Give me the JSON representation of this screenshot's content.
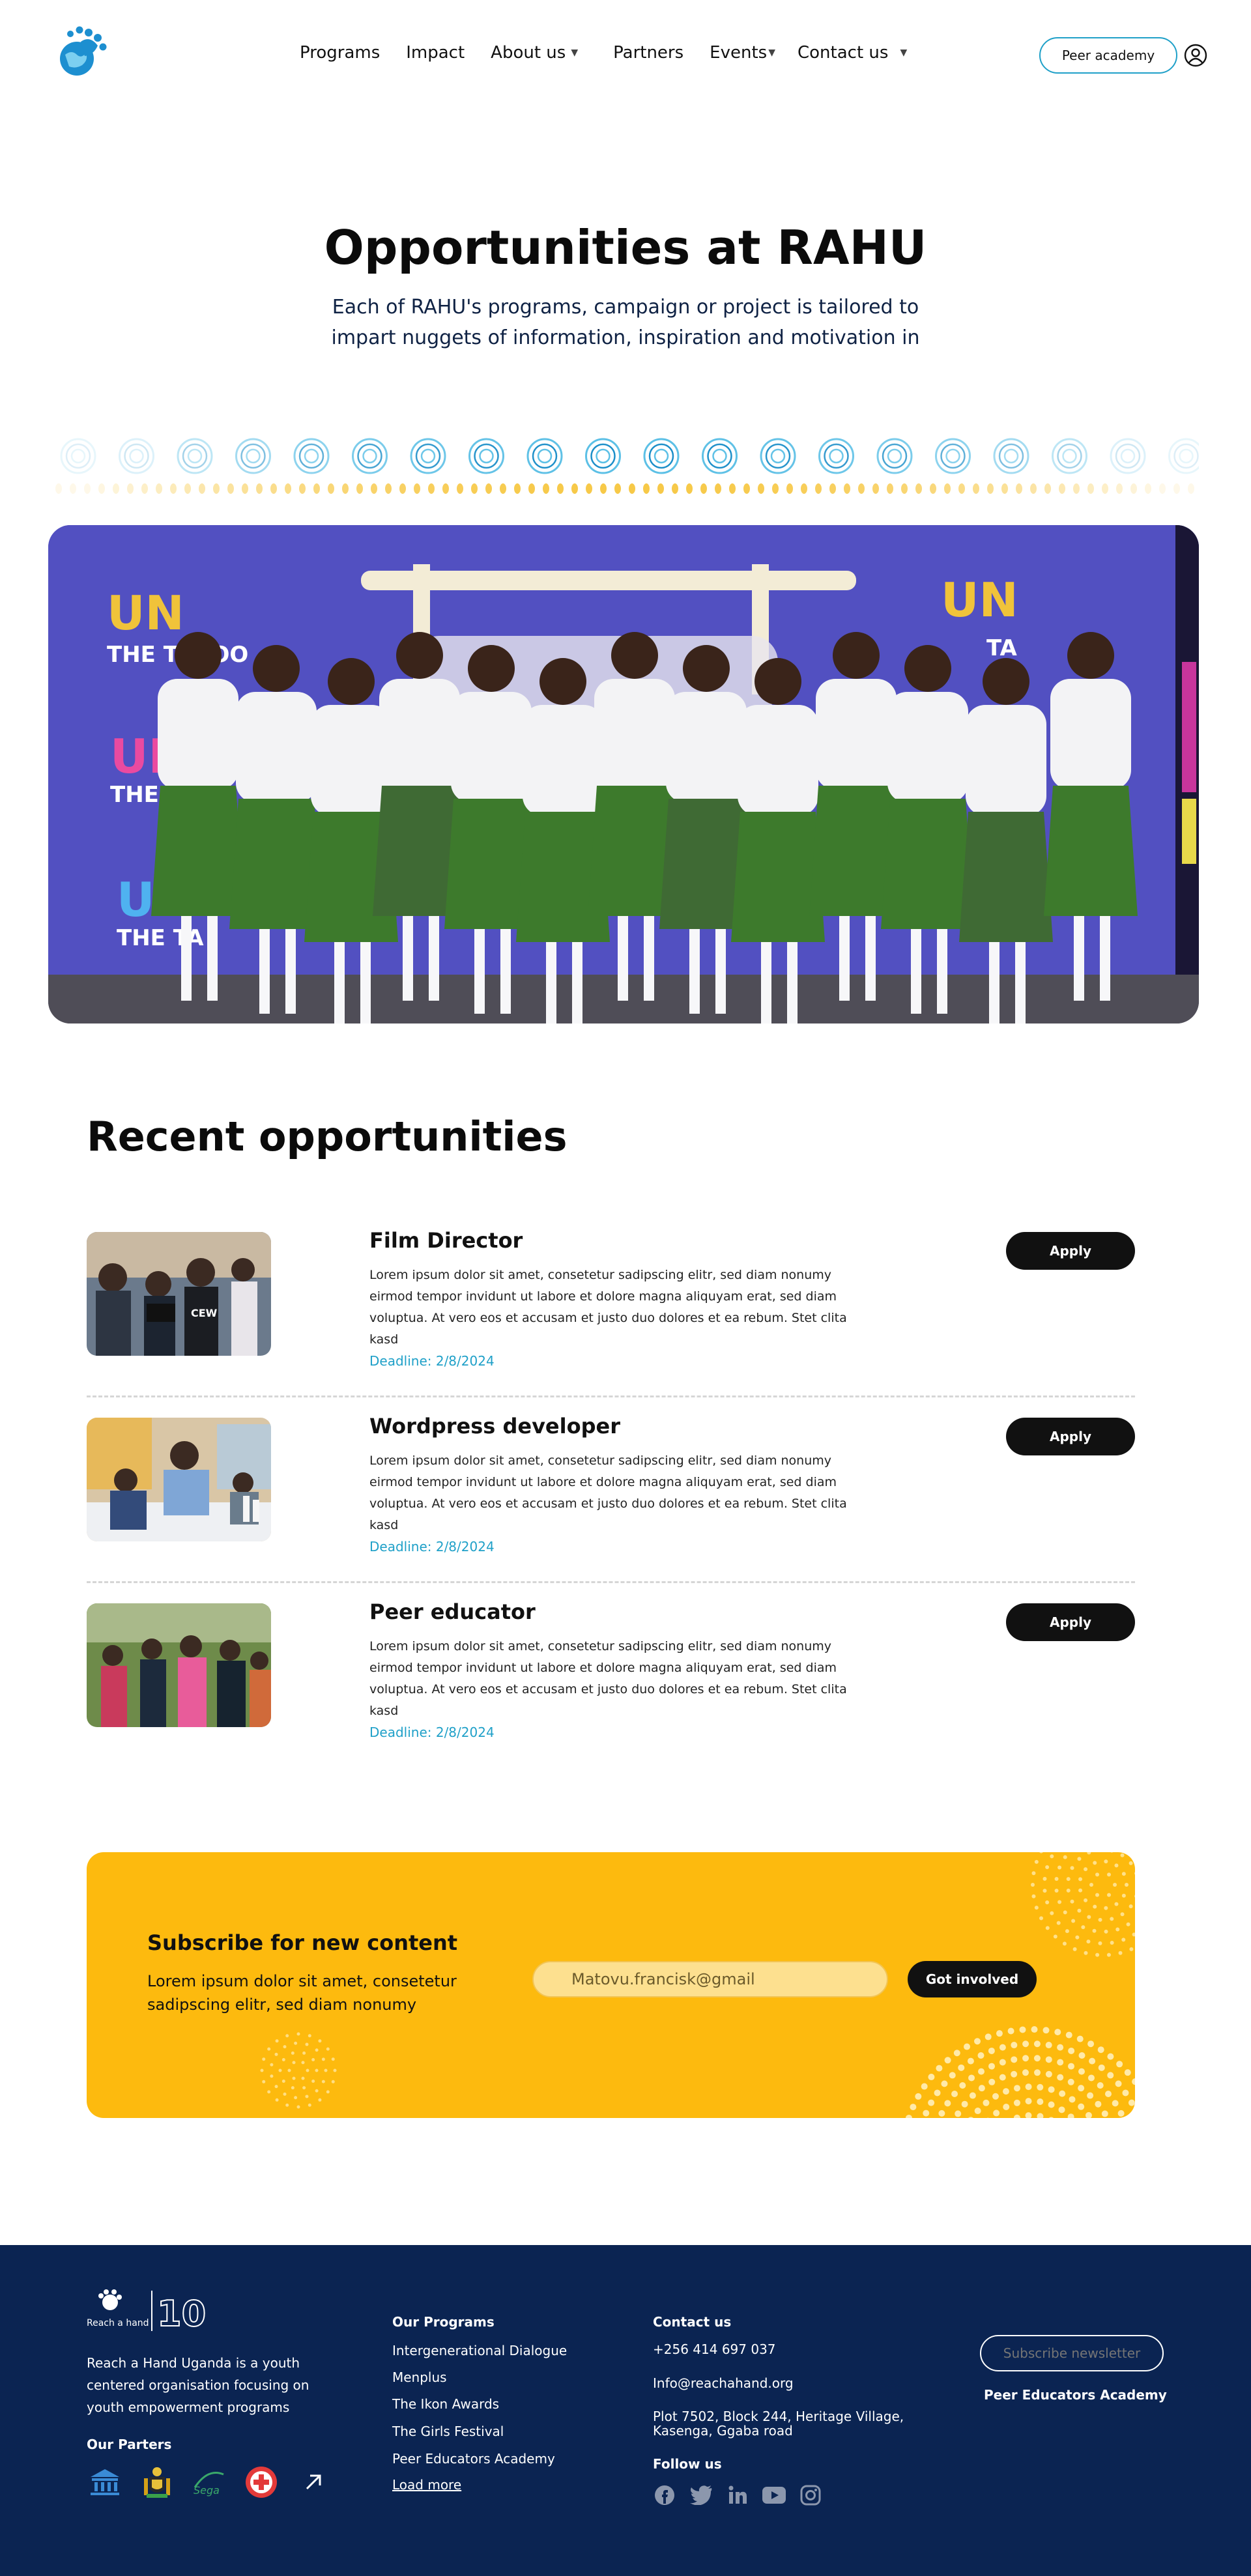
{
  "header": {
    "nav": [
      {
        "label": "Programs",
        "has_dropdown": false
      },
      {
        "label": "Impact",
        "has_dropdown": false
      },
      {
        "label": "About us",
        "has_dropdown": true
      },
      {
        "label": "Partners",
        "has_dropdown": false
      },
      {
        "label": "Events",
        "has_dropdown": true
      },
      {
        "label": "Contact us",
        "has_dropdown": true
      }
    ],
    "peer_academy_button": "Peer academy",
    "icons": {
      "logo": "rahu-hand-globe-logo",
      "user": "user-circle-icon",
      "dropdown": "caret-down-icon"
    }
  },
  "hero": {
    "title": "Opportunities at RAHU",
    "subtitle": "Each of RAHU's programs, campaign or project is tailored to impart nuggets of information, inspiration and motivation in"
  },
  "opportunities": {
    "title": "Recent opportunities",
    "items": [
      {
        "title": "Film Director",
        "description": "Lorem ipsum dolor sit amet, consetetur sadipscing elitr, sed diam nonumy eirmod tempor invidunt ut labore et dolore magna aliquyam erat, sed diam voluptua. At vero eos et accusam et justo duo dolores et ea rebum. Stet clita kasd",
        "deadline": "Deadline: 2/8/2024",
        "apply_label": "Apply"
      },
      {
        "title": "Wordpress developer",
        "description": "Lorem ipsum dolor sit amet, consetetur sadipscing elitr, sed diam nonumy eirmod tempor invidunt ut labore et dolore magna aliquyam erat, sed diam voluptua. At vero eos et accusam et justo duo dolores et ea rebum. Stet clita kasd",
        "deadline": "Deadline: 2/8/2024",
        "apply_label": "Apply"
      },
      {
        "title": "Peer educator",
        "description": "Lorem ipsum dolor sit amet, consetetur sadipscing elitr, sed diam nonumy eirmod tempor invidunt ut labore et dolore magna aliquyam erat, sed diam voluptua. At vero eos et accusam et justo duo dolores et ea rebum. Stet clita kasd",
        "deadline": "Deadline: 2/8/2024",
        "apply_label": "Apply"
      }
    ]
  },
  "subscribe": {
    "title": "Subscribe for new content",
    "text": "Lorem ipsum dolor sit amet, consetetur sadipscing elitr, sed diam nonumy",
    "email_value": "Matovu.francisk@gmail",
    "button": "Got involved"
  },
  "footer": {
    "about": "Reach a Hand Uganda is a youth centered organisation focusing on youth empowerment programs",
    "partners_heading": "Our Parters",
    "programs_heading": "Our Programs",
    "programs": [
      "Intergenerational Dialogue",
      "Menplus",
      "The Ikon Awards",
      "The Girls Festival",
      "Peer Educators Academy"
    ],
    "load_more": "Load more",
    "contact_heading": "Contact us",
    "phone": "+256 414 697 037",
    "email": "Info@reachahand.org",
    "address_line1": "Plot 7502, Block 244, Heritage Village,",
    "address_line2": "Kasenga, Ggaba road",
    "follow_heading": "Follow us",
    "social": [
      "facebook-icon",
      "twitter-icon",
      "linkedin-icon",
      "youtube-icon",
      "instagram-icon"
    ],
    "newsletter_placeholder": "Subscribe newsletter",
    "peer_link": "Peer Educators Academy",
    "logo_text": "Reach a hand",
    "logo_badge": "10"
  },
  "colors": {
    "accent_blue": "#1fa0c8",
    "yellow": "#fdba0e",
    "footer_navy": "#0b2452",
    "dark": "#111111"
  }
}
